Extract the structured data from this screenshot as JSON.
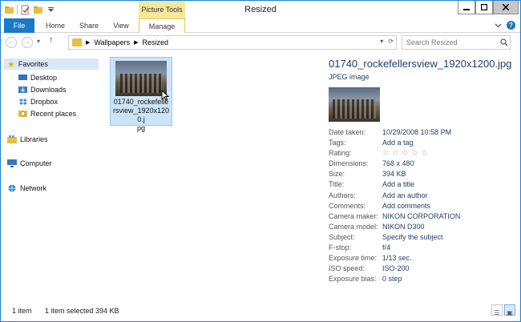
{
  "window": {
    "title": "Resized"
  },
  "titlebar": {
    "context_group": "Picture Tools"
  },
  "ribbon": {
    "tabs": [
      {
        "label": "File"
      },
      {
        "label": "Home"
      },
      {
        "label": "Share"
      },
      {
        "label": "View"
      },
      {
        "label": "Manage"
      }
    ],
    "help": "?"
  },
  "address": {
    "breadcrumb": [
      "Wallpapers",
      "Resized"
    ],
    "search_placeholder": "Search Resized"
  },
  "navpane": {
    "favorites": "Favorites",
    "favorite_items": [
      "Desktop",
      "Downloads",
      "Dropbox",
      "Recent places"
    ],
    "libraries": "Libraries",
    "computer": "Computer",
    "network": "Network"
  },
  "file": {
    "name_line1": "01740_rockefelle",
    "name_line2": "rsview_1920x1200.j",
    "name_line3": "pg"
  },
  "details": {
    "title": "01740_rockefellersview_1920x1200.jpg",
    "type": "JPEG image",
    "properties": [
      {
        "label": "Date taken:",
        "value": "10/29/2008 10:58 PM"
      },
      {
        "label": "Tags:",
        "value": "Add a tag"
      },
      {
        "label": "Rating:",
        "value": ""
      },
      {
        "label": "Dimensions:",
        "value": "768 x 480"
      },
      {
        "label": "Size:",
        "value": "394 KB"
      },
      {
        "label": "Title:",
        "value": "Add a title"
      },
      {
        "label": "Authors:",
        "value": "Add an author"
      },
      {
        "label": "Comments:",
        "value": "Add comments"
      },
      {
        "label": "Camera maker:",
        "value": "NIKON CORPORATION"
      },
      {
        "label": "Camera model:",
        "value": "NIKON D300"
      },
      {
        "label": "Subject:",
        "value": "Specify the subject"
      },
      {
        "label": "F-stop:",
        "value": "f/4"
      },
      {
        "label": "Exposure time:",
        "value": "1/13 sec."
      },
      {
        "label": "ISO speed:",
        "value": "ISO-200"
      },
      {
        "label": "Exposure bias:",
        "value": "0 step"
      }
    ],
    "rating_stars": 0
  },
  "status": {
    "item_count": "1 item",
    "selected": "1 item selected",
    "selected_size": "394 KB"
  },
  "colors": {
    "accent": "#1979ca",
    "context_tab": "#f6e79a",
    "selection": "#cce4f7"
  }
}
